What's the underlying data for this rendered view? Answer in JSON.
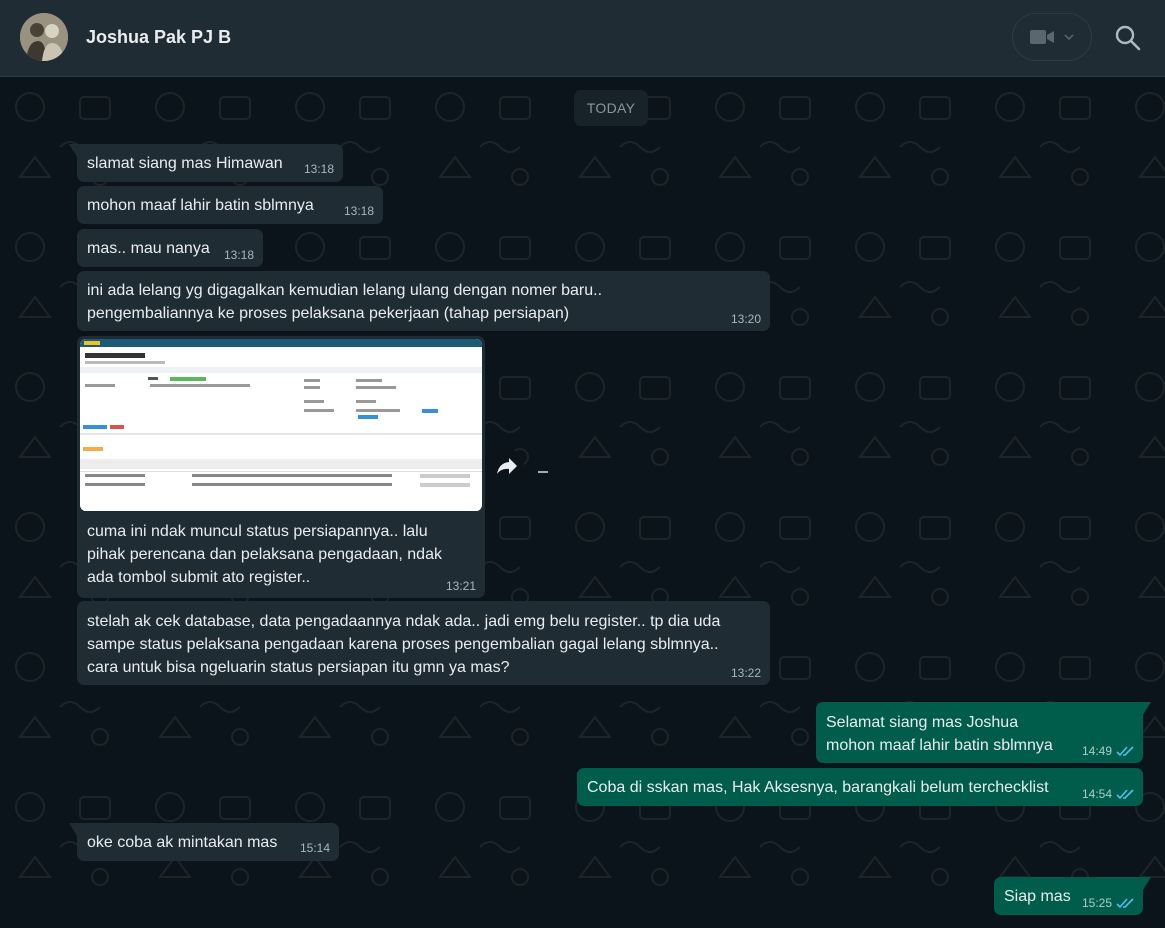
{
  "header": {
    "contact_name": "Joshua Pak PJ B",
    "video_icon": "video-camera-icon",
    "dropdown_icon": "chevron-down-icon",
    "search_icon": "search-icon"
  },
  "chat": {
    "date_divider": "TODAY",
    "messages": [
      {
        "dir": "in",
        "text": "slamat siang mas Himawan",
        "time": "13:18"
      },
      {
        "dir": "in",
        "text": "mohon maaf lahir batin sblmnya",
        "time": "13:18"
      },
      {
        "dir": "in",
        "text": "mas.. mau nanya",
        "time": "13:18"
      },
      {
        "dir": "in",
        "text": "ini ada lelang yg digagalkan kemudian lelang ulang dengan nomer baru..\npengembaliannya ke proses pelaksana pekerjaan (tahap persiapan)",
        "time": "13:20"
      },
      {
        "dir": "in",
        "text": "cuma ini ndak muncul status persiapannya.. lalu\npihak perencana dan pelaksana pengadaan, ndak\nada tombol submit ato register..",
        "time": "13:21",
        "image": {
          "title": "Procurement Plan"
        }
      },
      {
        "dir": "in",
        "text": "stelah ak cek database, data pengadaannya ndak ada.. jadi emg belu register.. tp dia uda\nsampe status pelaksana pengadaan karena proses pengembalian gagal lelang sblmnya..\ncara untuk bisa ngeluarin status persiapan itu gmn ya mas?",
        "time": "13:22"
      },
      {
        "dir": "out",
        "text": "Selamat siang mas Joshua\nmohon maaf lahir batin sblmnya",
        "time": "14:49"
      },
      {
        "dir": "out",
        "text": "Coba di sskan mas, Hak Aksesnya, barangkali belum terchecklist",
        "time": "14:54"
      },
      {
        "dir": "in",
        "text": "oke coba ak mintakan mas",
        "time": "15:14"
      },
      {
        "dir": "out",
        "text": "Siap mas",
        "time": "15:25"
      }
    ]
  },
  "colors": {
    "header_bg": "#202c33",
    "chat_bg": "#0b141a",
    "incoming_bubble": "#202c33",
    "outgoing_bubble": "#005c4b",
    "read_tick": "#53bdeb"
  }
}
